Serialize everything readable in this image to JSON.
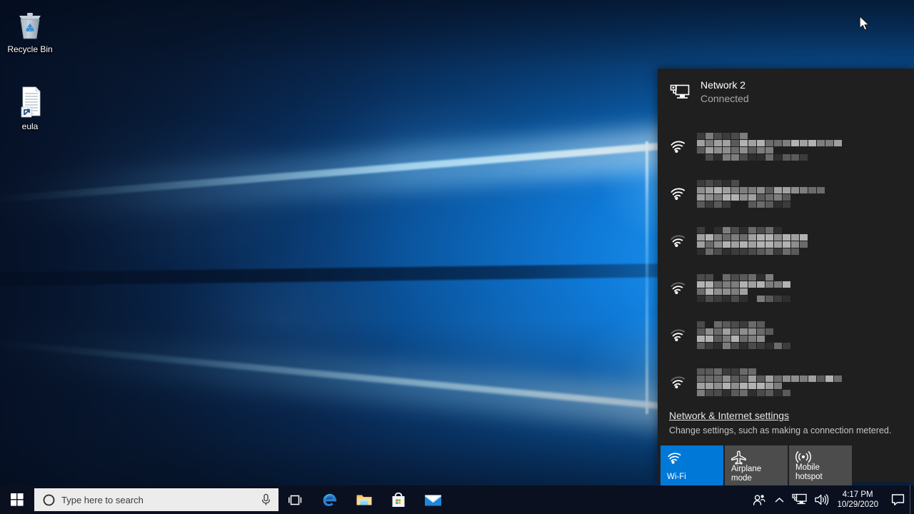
{
  "desktop": {
    "icons": [
      {
        "id": "recycle-bin",
        "label": "Recycle Bin",
        "icon": "recycle-bin-icon"
      },
      {
        "id": "eula",
        "label": "eula",
        "icon": "text-document-shortcut-icon"
      }
    ]
  },
  "flyout": {
    "header": {
      "icon": "ethernet-monitor-icon",
      "name": "Network 2",
      "status": "Connected"
    },
    "networks": [
      {
        "id": "net-1",
        "name": "",
        "redacted": true,
        "signal": 3,
        "icon": "wifi-icon"
      },
      {
        "id": "net-2",
        "name": "",
        "redacted": true,
        "signal": 3,
        "icon": "wifi-icon"
      },
      {
        "id": "net-3",
        "name": "",
        "redacted": true,
        "signal": 2,
        "icon": "wifi-icon"
      },
      {
        "id": "net-4",
        "name": "",
        "redacted": true,
        "signal": 2,
        "icon": "wifi-icon"
      },
      {
        "id": "net-5",
        "name": "",
        "redacted": true,
        "signal": 2,
        "icon": "wifi-icon"
      },
      {
        "id": "net-6",
        "name": "",
        "redacted": true,
        "signal": 2,
        "icon": "wifi-icon"
      }
    ],
    "settings": {
      "link": "Network & Internet settings",
      "description": "Change settings, such as making a connection metered."
    },
    "tiles": [
      {
        "id": "wifi",
        "label": "Wi-Fi",
        "icon": "wifi-icon",
        "active": true
      },
      {
        "id": "airplane-mode",
        "label": "Airplane mode",
        "icon": "airplane-icon",
        "active": false
      },
      {
        "id": "mobile-hotspot",
        "label": "Mobile\nhotspot",
        "label_line1": "Mobile",
        "label_line2": "hotspot",
        "icon": "broadcast-icon",
        "active": false
      }
    ]
  },
  "taskbar": {
    "start": {
      "icon": "windows-logo-icon",
      "label": "Start"
    },
    "search": {
      "placeholder": "Type here to search",
      "value": "",
      "cortana_icon": "cortana-circle-icon",
      "mic_icon": "microphone-icon"
    },
    "task_view": {
      "icon": "task-view-icon",
      "label": "Task View"
    },
    "pinned": [
      {
        "id": "edge",
        "label": "Microsoft Edge",
        "icon": "edge-icon"
      },
      {
        "id": "file-explorer",
        "label": "File Explorer",
        "icon": "folder-icon"
      },
      {
        "id": "store",
        "label": "Microsoft Store",
        "icon": "store-bag-icon"
      },
      {
        "id": "mail",
        "label": "Mail",
        "icon": "mail-envelope-icon"
      }
    ],
    "tray": [
      {
        "id": "people",
        "icon": "people-icon",
        "label": "People"
      },
      {
        "id": "show-hidden",
        "icon": "chevron-up-icon",
        "label": "Show hidden icons"
      },
      {
        "id": "network",
        "icon": "ethernet-monitor-icon",
        "label": "Network"
      },
      {
        "id": "volume",
        "icon": "speaker-icon",
        "label": "Volume"
      }
    ],
    "clock": {
      "time": "4:17 PM",
      "date": "10/29/2020"
    },
    "action_center": {
      "icon": "speech-bubble-icon",
      "label": "Action Center"
    }
  },
  "colors": {
    "accent": "#0078d7",
    "flyout_bg": "#1f1f1f",
    "tile_inactive": "#4c4c4c",
    "taskbar_bg": "#0a1020",
    "search_bg": "#ececec"
  }
}
